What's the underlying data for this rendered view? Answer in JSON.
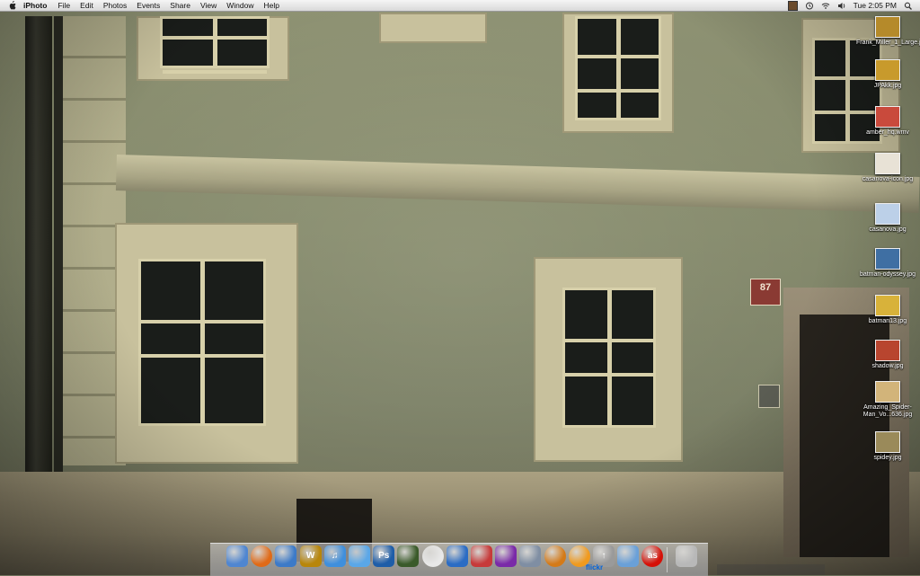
{
  "menubar": {
    "app_name": "iPhoto",
    "menus": [
      "File",
      "Edit",
      "Photos",
      "Events",
      "Share",
      "View",
      "Window",
      "Help"
    ],
    "clock": "Tue 2:05 PM",
    "apple_icon": "apple-logo-icon"
  },
  "desktop": {
    "plaque_number": "87",
    "icons": [
      {
        "label": "Frank_Miller_1_Large.jpg",
        "icon": "image-file-icon",
        "color": "#b58a2a"
      },
      {
        "label": "JPAkk.jpg",
        "icon": "image-file-icon",
        "color": "#c89a2c"
      },
      {
        "label": "amber_hq.wmv",
        "icon": "video-file-icon",
        "color": "#c94a3c"
      },
      {
        "label": "casanova-icon.jpg",
        "icon": "image-file-icon",
        "color": "#e8e2d6"
      },
      {
        "label": "casanova.jpg",
        "icon": "image-file-icon",
        "color": "#bcd0e8"
      },
      {
        "label": "batman-odyssey.jpg",
        "icon": "image-file-icon",
        "color": "#3f6fa3"
      },
      {
        "label": "batman13.jpg",
        "icon": "image-file-icon",
        "color": "#d8b23a"
      },
      {
        "label": "shadow.jpg",
        "icon": "image-file-icon",
        "color": "#b8452f"
      },
      {
        "label": "Amazing_Spider-Man_Vo...636.jpg",
        "icon": "image-file-icon",
        "color": "#d2b47a"
      },
      {
        "label": "spidey.jpg",
        "icon": "image-file-icon",
        "color": "#9a8a5a"
      }
    ]
  },
  "dock": {
    "items": [
      {
        "name": "Finder",
        "icon": "finder-icon",
        "color": "#4f86d1",
        "glyph": ""
      },
      {
        "name": "Firefox",
        "icon": "firefox-icon",
        "color": "#e06a17",
        "glyph": ""
      },
      {
        "name": "Mail",
        "icon": "mail-icon",
        "color": "#3c7ac8",
        "glyph": ""
      },
      {
        "name": "World of Warcraft",
        "icon": "wow-icon",
        "color": "#b8860b",
        "glyph": "W"
      },
      {
        "name": "iTunes",
        "icon": "itunes-icon",
        "color": "#3f8fdc",
        "glyph": "♫"
      },
      {
        "name": "iWeb",
        "icon": "iweb-icon",
        "color": "#5aa7e8",
        "glyph": ""
      },
      {
        "name": "Photoshop",
        "icon": "photoshop-icon",
        "color": "#1e5da8",
        "glyph": "Ps"
      },
      {
        "name": "Adium",
        "icon": "duck-icon",
        "color": "#3a5a2a",
        "glyph": ""
      },
      {
        "name": "Safari",
        "icon": "safari-icon",
        "color": "#e8e8e8",
        "glyph": ""
      },
      {
        "name": "Network Utility",
        "icon": "network-icon",
        "color": "#2b6cc4",
        "glyph": ""
      },
      {
        "name": "Script Editor",
        "icon": "script-icon",
        "color": "#c73a3a",
        "glyph": ""
      },
      {
        "name": "Front Row",
        "icon": "frontrow-icon",
        "color": "#7a2aa8",
        "glyph": ""
      },
      {
        "name": "Transmit",
        "icon": "truck-icon",
        "color": "#7f8ea3",
        "glyph": ""
      },
      {
        "name": "Growl",
        "icon": "growl-icon",
        "color": "#d47a18",
        "glyph": ""
      },
      {
        "name": "Vuze",
        "icon": "vuze-icon",
        "color": "#f09a1e",
        "glyph": ""
      },
      {
        "name": "Flickr Uploadr",
        "icon": "upload-arrow-icon",
        "color": "#9a9a9a",
        "glyph": "↑"
      },
      {
        "name": "iPhoto",
        "icon": "iphoto-icon",
        "color": "#6aa0d8",
        "glyph": ""
      },
      {
        "name": "Last.fm",
        "icon": "lastfm-icon",
        "color": "#d51007",
        "glyph": "as"
      },
      {
        "name": "Trash",
        "icon": "trash-icon",
        "color": "#b8b8b8",
        "glyph": ""
      }
    ],
    "flickr_text": "flickr"
  }
}
